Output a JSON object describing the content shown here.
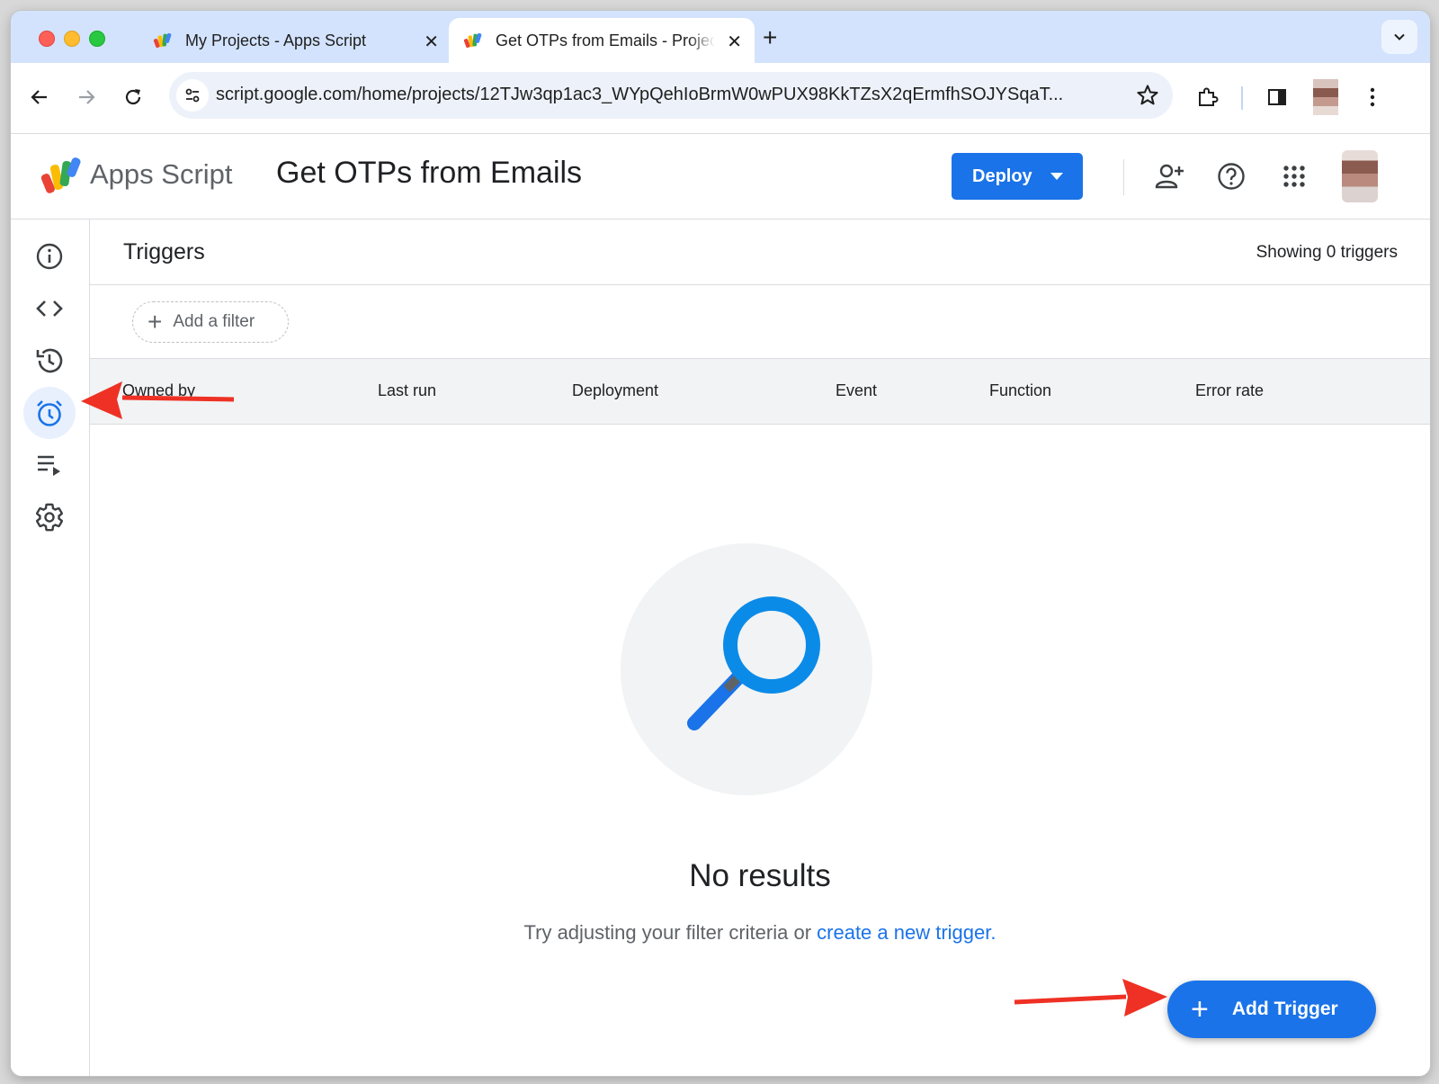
{
  "browser": {
    "tabs": [
      {
        "title": "My Projects - Apps Script",
        "active": false
      },
      {
        "title": "Get OTPs from Emails - Project Editor - Apps Script",
        "active": true
      }
    ],
    "new_tab_icon": "plus-icon",
    "url": "script.google.com/home/projects/12TJw3qp1ac3_WYpQehIoBrmW0wPUX98KkTZsX2qErmfhSOJYSqaT..."
  },
  "app": {
    "product_name": "Apps Script",
    "project_name": "Get OTPs from Emails",
    "deploy_label": "Deploy",
    "accent_color": "#1a73e8"
  },
  "sidebar": {
    "items": [
      {
        "name": "overview",
        "icon": "info-icon"
      },
      {
        "name": "editor",
        "icon": "code-icon"
      },
      {
        "name": "project-history",
        "icon": "history-icon"
      },
      {
        "name": "triggers",
        "icon": "alarm-clock-icon",
        "active": true
      },
      {
        "name": "executions",
        "icon": "executions-list-icon"
      },
      {
        "name": "project-settings",
        "icon": "gear-icon"
      }
    ]
  },
  "main": {
    "title": "Triggers",
    "showing_text": "Showing 0 triggers",
    "add_filter_label": "Add a filter",
    "columns": [
      "Owned by",
      "Last run",
      "Deployment",
      "Event",
      "Function",
      "Error rate"
    ],
    "empty": {
      "title": "No results",
      "subtitle_prefix": "Try adjusting your filter criteria or ",
      "subtitle_link": "create a new trigger."
    },
    "add_trigger_label": "Add Trigger"
  }
}
